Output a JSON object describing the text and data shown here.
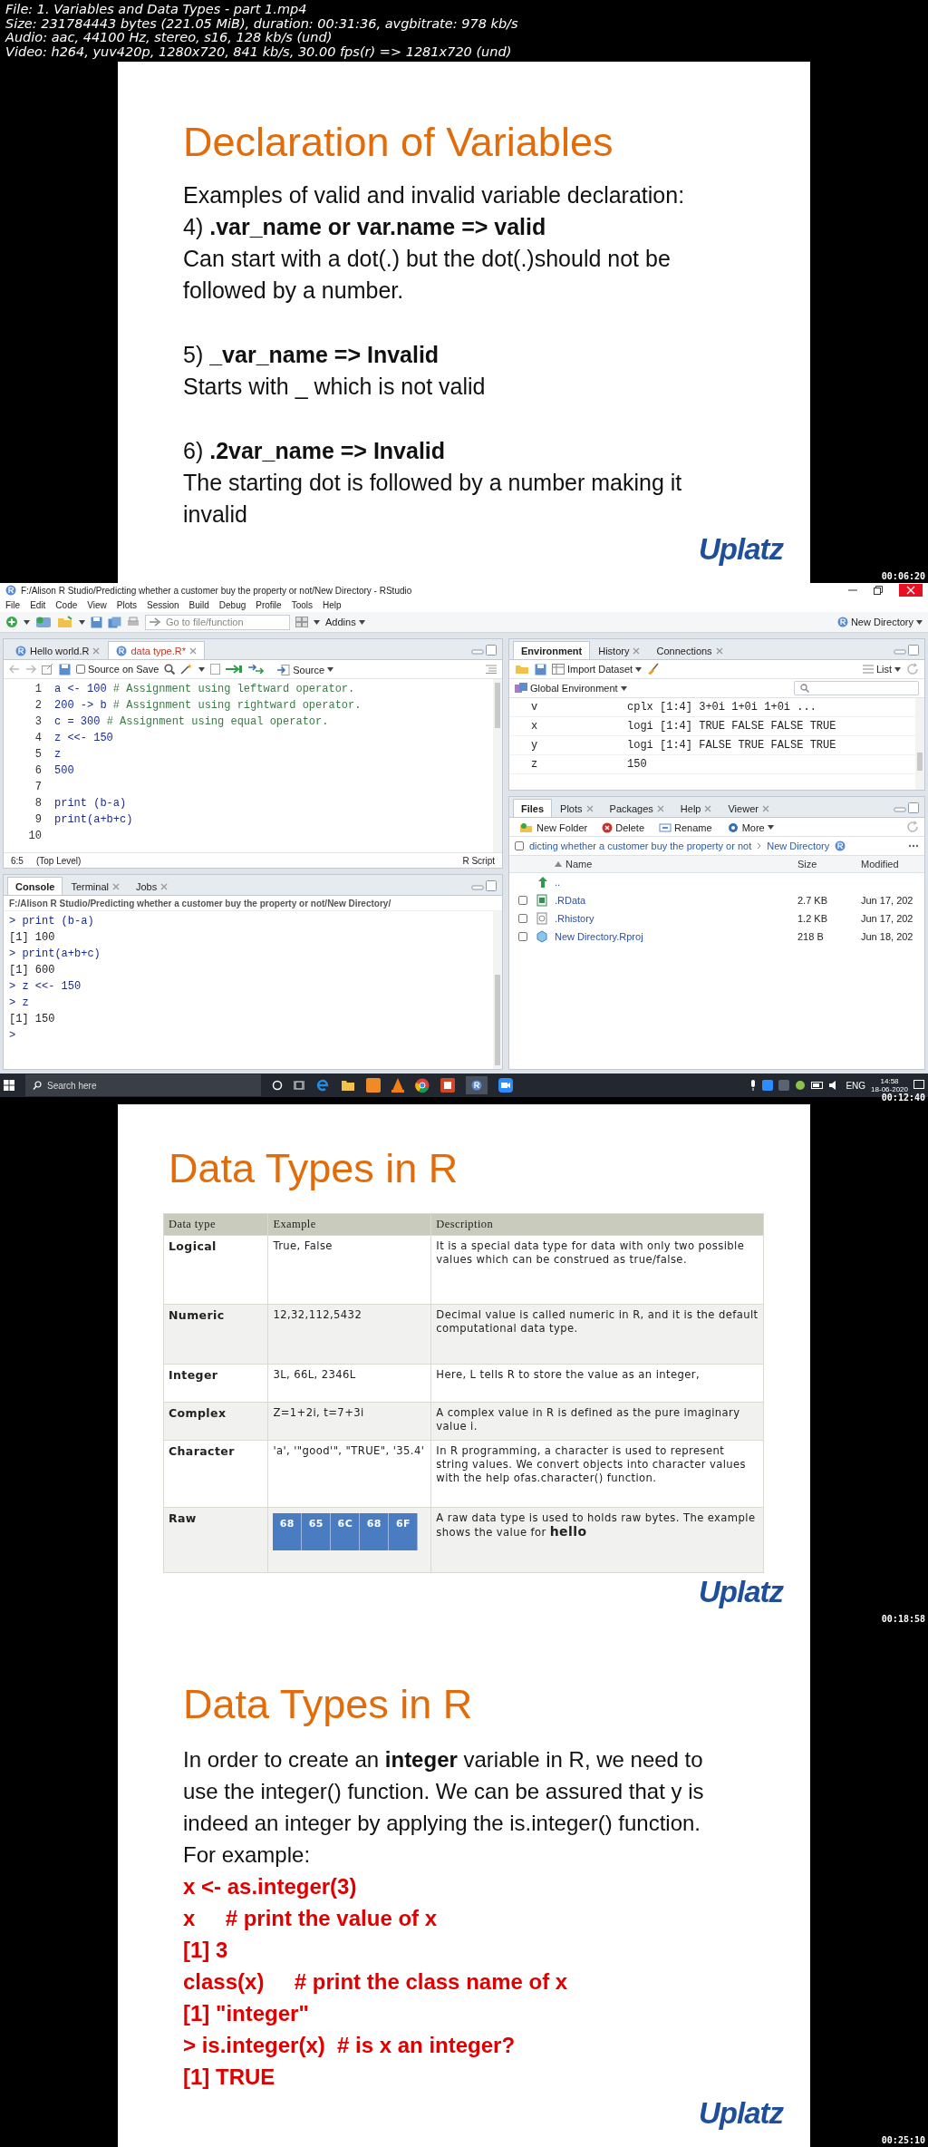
{
  "file_info": [
    "File: 1. Variables and Data Types - part 1.mp4",
    "Size: 231784443 bytes (221.05 MiB), duration: 00:31:36, avgbitrate: 978 kb/s",
    "Audio: aac, 44100 Hz, stereo, s16, 128 kb/s (und)",
    "Video: h264, yuv420p, 1280x720, 841 kb/s, 30.00 fps(r) => 1281x720 (und)"
  ],
  "frames": [
    {
      "kind": "text_slide",
      "timestamp": "00:06:20",
      "title": "Declaration of Variables",
      "logo": "Uplatz",
      "groups": [
        [
          "Examples of valid and invalid variable declaration:",
          "4) **.var_name or var.name     => valid**",
          "Can start with a dot(.) but the dot(.)should not be followed by a number."
        ],
        [
          "5) **_var_name      => Invalid**",
          "Starts with _ which is not valid"
        ],
        [
          "6) **.2var_name      => Invalid**",
          "The starting dot is followed by a number making it invalid"
        ]
      ]
    },
    {
      "kind": "rstudio",
      "timestamp": "00:12:40",
      "title": "F:/Alison R Studio/Predicting whether a customer buy the property or not/New Directory - RStudio",
      "menu": [
        "File",
        "Edit",
        "Code",
        "View",
        "Plots",
        "Session",
        "Build",
        "Debug",
        "Profile",
        "Tools",
        "Help"
      ],
      "goto_placeholder": "Go to file/function",
      "addins": "Addins",
      "project": "New Directory",
      "editor": {
        "tabs": [
          {
            "label": "Hello world.R",
            "selected": false,
            "modified": false
          },
          {
            "label": "data type.R*",
            "selected": true,
            "modified": true
          }
        ],
        "source_on_save": {
          "label": "Source on Save",
          "checked": false
        },
        "source": "Source",
        "lines": [
          {
            "num": "1",
            "code": "a <- 100",
            "comment": "# Assignment using leftward operator."
          },
          {
            "num": "2",
            "code": "200 -> b",
            "comment": "# Assignment using rightward operator."
          },
          {
            "num": "3",
            "code": "c = 300",
            "comment": "# Assignment using equal operator."
          },
          {
            "num": "4",
            "code": "z <<- 150"
          },
          {
            "num": "5",
            "code": "z"
          },
          {
            "num": "6",
            "code": "500"
          },
          {
            "num": "7"
          },
          {
            "num": "8",
            "code": "print (b-a)"
          },
          {
            "num": "9",
            "code": "print(a+b+c)"
          },
          {
            "num": "10"
          }
        ],
        "cursor": "6:5",
        "scope": "(Top Level)",
        "file_type": "R Script"
      },
      "console": {
        "tabs": [
          {
            "label": "Console",
            "selected": true
          },
          {
            "label": "Terminal",
            "selected": false
          },
          {
            "label": "Jobs",
            "selected": false
          }
        ],
        "path": "F:/Alison R Studio/Predicting whether a customer buy the property or not/New Directory/",
        "lines": [
          {
            "kind": "input",
            "text": "> print (b-a)"
          },
          {
            "kind": "output",
            "text": "[1] 100"
          },
          {
            "kind": "input",
            "text": "> print(a+b+c)"
          },
          {
            "kind": "output",
            "text": "[1] 600"
          },
          {
            "kind": "input",
            "text": "> z <<- 150"
          },
          {
            "kind": "input",
            "text": "> z"
          },
          {
            "kind": "output",
            "text": "[1] 150"
          },
          {
            "kind": "input",
            "text": ">"
          }
        ]
      },
      "environment": {
        "tabs": [
          {
            "label": "Environment",
            "selected": true
          },
          {
            "label": "History",
            "selected": false
          },
          {
            "label": "Connections",
            "selected": false
          }
        ],
        "import": "Import Dataset",
        "view": "List",
        "scope": "Global Environment",
        "rows": [
          {
            "name": "v",
            "value": "cplx [1:4] 3+0i 1+0i 1+0i ..."
          },
          {
            "name": "x",
            "value": "logi [1:4] TRUE FALSE FALSE TRUE"
          },
          {
            "name": "y",
            "value": "logi [1:4] FALSE TRUE FALSE TRUE"
          },
          {
            "name": "z",
            "value": "150"
          }
        ]
      },
      "files": {
        "tabs": [
          {
            "label": "Files",
            "selected": true
          },
          {
            "label": "Plots",
            "selected": false
          },
          {
            "label": "Packages",
            "selected": false
          },
          {
            "label": "Help",
            "selected": false
          },
          {
            "label": "Viewer",
            "selected": false
          }
        ],
        "actions": [
          {
            "kind": "new_folder",
            "label": "New Folder"
          },
          {
            "kind": "delete",
            "label": "Delete"
          },
          {
            "kind": "rename",
            "label": "Rename"
          },
          {
            "kind": "more",
            "label": "More"
          }
        ],
        "path_checked": false,
        "path": [
          "dicting whether a customer buy the property or not",
          "New Directory"
        ],
        "columns": [
          "Name",
          "Size",
          "Modified"
        ],
        "rows": [
          {
            "kind": "parent",
            "name": ".."
          },
          {
            "kind": "data",
            "name": ".RData",
            "size": "2.7 KB",
            "modified": "Jun 17, 202",
            "checked": false
          },
          {
            "kind": "history",
            "name": ".Rhistory",
            "size": "1.2 KB",
            "modified": "Jun 17, 202",
            "checked": false
          },
          {
            "kind": "project",
            "name": "New Directory.Rproj",
            "size": "218 B",
            "modified": "Jun 18, 202",
            "checked": false
          }
        ]
      },
      "taskbar": {
        "search_placeholder": "Search here",
        "language": "ENG",
        "time": "14:58",
        "date": "18-06-2020"
      }
    },
    {
      "kind": "table_slide",
      "timestamp": "00:18:58",
      "title": "Data Types in R",
      "logo": "Uplatz",
      "columns": [
        "Data type",
        "Example",
        "Description"
      ],
      "rows": [
        {
          "kind": "text",
          "type": "Logical",
          "example": "True, False",
          "description": "It is a special data type for data with only two possible values which can be construed as true/false."
        },
        {
          "kind": "text",
          "type": "Numeric",
          "example": "12,32,112,5432",
          "description": "Decimal value is called numeric in R, and it is the default computational data type."
        },
        {
          "kind": "text",
          "type": "Integer",
          "example": "3L, 66L, 2346L",
          "description": "Here, L tells R to store the value as an integer,"
        },
        {
          "kind": "text",
          "type": "Complex",
          "example": "Z=1+2i, t=7+3i",
          "description": "A complex value in R is defined as the pure imaginary value i."
        },
        {
          "kind": "text",
          "type": "Character",
          "example": "'a', '\"good'\", \"TRUE\", '35.4'",
          "description": "In R programming, a character is used to represent string values. We convert objects into character values with the help ofas.character() function."
        },
        {
          "kind": "bytes",
          "type": "Raw",
          "bytes": [
            "68",
            "65",
            "6C",
            "68",
            "6F"
          ],
          "description": "A raw data type is used to holds raw bytes. The example shows the value for **hello**"
        }
      ]
    },
    {
      "kind": "example_slide",
      "timestamp": "00:25:10",
      "title": "Data Types in R",
      "logo": "Uplatz",
      "lines": [
        {
          "kind": "text",
          "text": "In order to create an **integer** variable in R, we need to use the integer() function. We can be assured that y is indeed an integer by applying the is.integer() function."
        },
        {
          "kind": "text",
          "text": "For example:"
        },
        {
          "kind": "code",
          "text": "x <- as.integer(3)"
        },
        {
          "kind": "code",
          "text": "x     # print the value of x"
        },
        {
          "kind": "code",
          "text": "[1] 3"
        },
        {
          "kind": "code",
          "text": "class(x)     # print the class name of x"
        },
        {
          "kind": "code",
          "text": "[1] \"integer\""
        },
        {
          "kind": "code",
          "text": "> is.integer(x)  # is x an integer?"
        },
        {
          "kind": "code",
          "text": "[1] TRUE"
        }
      ]
    }
  ]
}
